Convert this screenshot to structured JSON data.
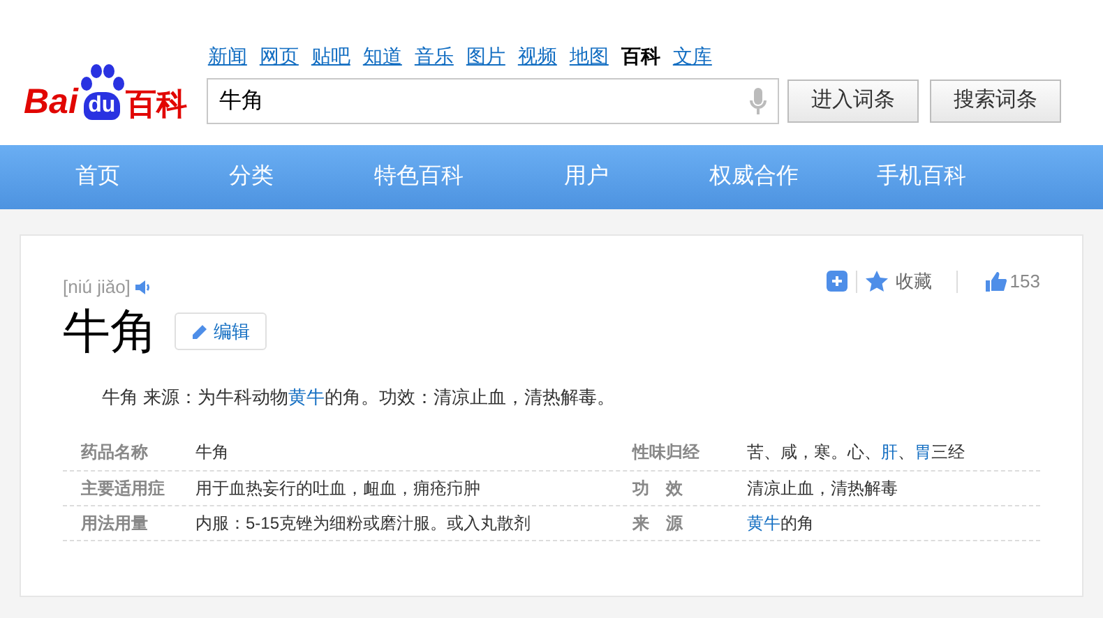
{
  "logo": {
    "parts": [
      "Bai",
      "du",
      "百科"
    ]
  },
  "top_links": [
    {
      "label": "新闻",
      "selected": false
    },
    {
      "label": "网页",
      "selected": false
    },
    {
      "label": "贴吧",
      "selected": false
    },
    {
      "label": "知道",
      "selected": false
    },
    {
      "label": "音乐",
      "selected": false
    },
    {
      "label": "图片",
      "selected": false
    },
    {
      "label": "视频",
      "selected": false
    },
    {
      "label": "地图",
      "selected": false
    },
    {
      "label": "百科",
      "selected": true
    },
    {
      "label": "文库",
      "selected": false
    }
  ],
  "search": {
    "value": "牛角"
  },
  "buttons": [
    "进入词条",
    "搜索词条"
  ],
  "nav": [
    "首页",
    "分类",
    "特色百科",
    "用户",
    "权威合作",
    "手机百科"
  ],
  "entry": {
    "pinyin": "[niú jiǎo]",
    "title": "牛角",
    "edit": "编辑",
    "favorite": "收藏",
    "likes": "153",
    "summary": [
      {
        "text": "牛角 来源：为牛科动物",
        "link": false
      },
      {
        "text": "黄牛",
        "link": true
      },
      {
        "text": "的角。功效：清凉止血，清热解毒。",
        "link": false
      }
    ]
  },
  "info_rows": [
    {
      "label_1": "药品名称",
      "value_1": [
        {
          "text": "牛角",
          "link": false
        }
      ],
      "label_2": "性味归经",
      "value_2": [
        {
          "text": "苦、咸，寒。心、",
          "link": false
        },
        {
          "text": "肝",
          "link": true
        },
        {
          "text": "、",
          "link": false
        },
        {
          "text": "胃",
          "link": true
        },
        {
          "text": "三经",
          "link": false
        }
      ]
    },
    {
      "label_1": "主要适用症",
      "value_1": [
        {
          "text": "用于血热妄行的吐血，衄血，痈疮疖肿",
          "link": false
        }
      ],
      "label_2": "功　效",
      "value_2": [
        {
          "text": "清凉止血，清热解毒",
          "link": false
        }
      ]
    },
    {
      "label_1": "用法用量",
      "value_1": [
        {
          "text": "内服：5-15克锉为细粉或磨汁服。或入丸散剂",
          "link": false
        }
      ],
      "label_2": "来　源",
      "value_2": [
        {
          "text": "黄牛",
          "link": true
        },
        {
          "text": "的角",
          "link": false
        }
      ]
    }
  ]
}
